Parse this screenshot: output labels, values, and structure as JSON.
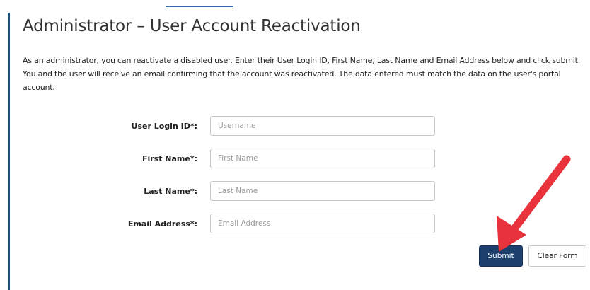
{
  "page": {
    "title": "Administrator – User Account Reactivation",
    "intro": "As an administrator, you can reactivate a disabled user. Enter their User Login ID, First Name, Last Name and Email Address below and click submit. You and the user will receive an email confirming that the account was reactivated. The data entered must match the data on the user's portal account."
  },
  "form": {
    "fields": [
      {
        "label": "User Login ID*:",
        "placeholder": "Username",
        "value": ""
      },
      {
        "label": "First Name*:",
        "placeholder": "First Name",
        "value": ""
      },
      {
        "label": "Last Name*:",
        "placeholder": "Last Name",
        "value": ""
      },
      {
        "label": "Email Address*:",
        "placeholder": "Email Address",
        "value": ""
      }
    ],
    "submit_label": "Submit",
    "clear_label": "Clear Form"
  },
  "annotation": {
    "arrow_color": "#e8323c"
  },
  "colors": {
    "accent_blue": "#1c3f6e",
    "rule_blue": "#1f4e79"
  }
}
